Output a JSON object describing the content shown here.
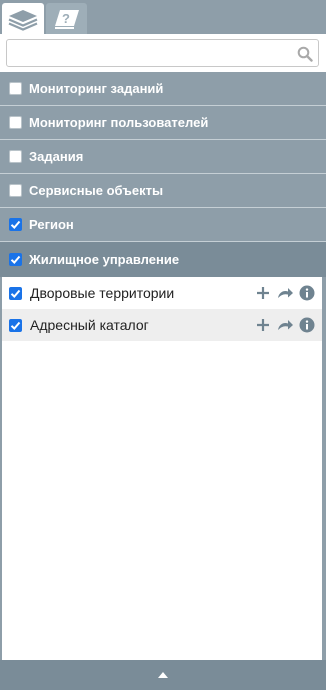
{
  "tabs": [
    {
      "icon": "layers-icon",
      "active": true
    },
    {
      "icon": "legend-question-icon",
      "active": false
    }
  ],
  "search": {
    "value": "",
    "placeholder": "",
    "icon": "search-icon"
  },
  "groups": [
    {
      "label": "Мониторинг заданий",
      "checked": false
    },
    {
      "label": "Мониторинг пользователей",
      "checked": false
    },
    {
      "label": "Задания",
      "checked": false
    },
    {
      "label": "Сервисные объекты",
      "checked": false
    },
    {
      "label": "Регион",
      "checked": true
    },
    {
      "label": "Жилищное управление",
      "checked": true
    }
  ],
  "layers": [
    {
      "label": "Дворовые территории",
      "checked": true
    },
    {
      "label": "Адресный каталог",
      "checked": true
    }
  ],
  "layer_actions": [
    "add-icon",
    "redo-arrow-icon",
    "info-icon"
  ],
  "bottom": {
    "icon": "collapse-up-icon"
  },
  "colors": {
    "panel": "#8e9ea9",
    "header_dark": "#7a8c98",
    "checkbox": "#1a73e8",
    "icon": "#6f8390"
  }
}
